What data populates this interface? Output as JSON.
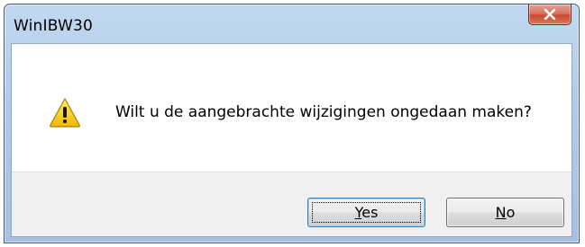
{
  "window": {
    "title": "WinIBW30"
  },
  "dialog": {
    "icon": "warning-icon",
    "message": "Wilt u de aangebrachte wijzigingen ongedaan maken?"
  },
  "buttons": {
    "yes": {
      "mnemonic": "Y",
      "rest": "es",
      "is_default": true
    },
    "no": {
      "mnemonic": "N",
      "rest": "o",
      "is_default": false
    }
  },
  "colors": {
    "title_bar": "#b3cbe8",
    "close_button": "#c84a33",
    "footer": "#f0f0f0",
    "warning_yellow": "#f5c400"
  }
}
